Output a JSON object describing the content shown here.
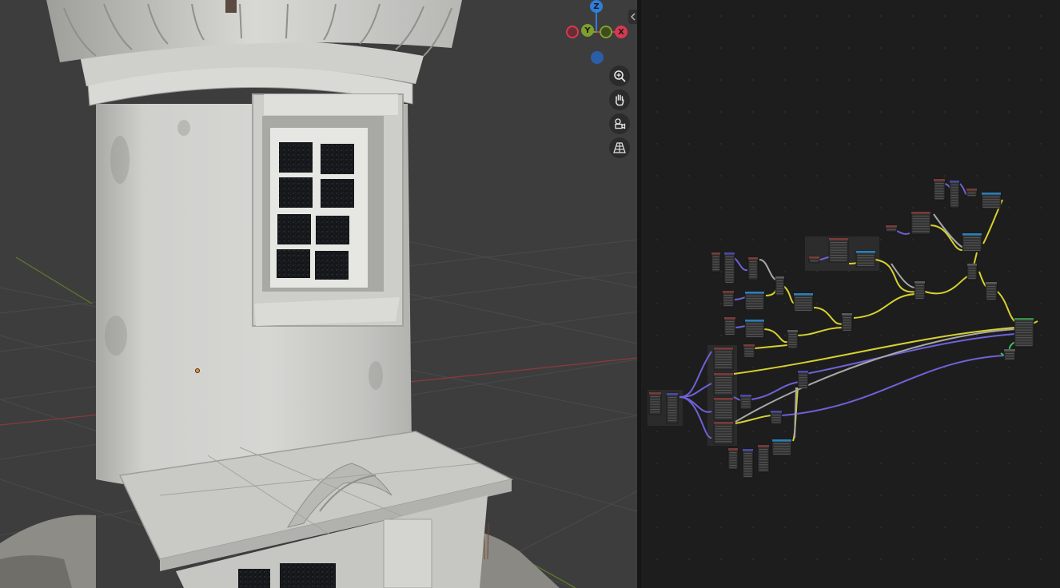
{
  "app": "Blender",
  "viewport": {
    "background": "#3d3d3d",
    "gizmo": {
      "z_label": "Z",
      "y_label": "Y",
      "x_label": "X",
      "x_color": "#d8394f",
      "y_color": "#7ea02b",
      "z_color": "#2f7ed8"
    },
    "nav_buttons": [
      {
        "icon": "zoom-icon"
      },
      {
        "icon": "hand-pan-icon"
      },
      {
        "icon": "camera-view-icon"
      },
      {
        "icon": "perspective-grid-icon"
      }
    ]
  },
  "node_editor": {
    "background": "#1d1d1d",
    "link_colors": {
      "color_socket": "#d7d12f",
      "vector_socket": "#6e62d8",
      "float_socket": "#a8a8a8",
      "shader_socket": "#3ec35c"
    }
  }
}
